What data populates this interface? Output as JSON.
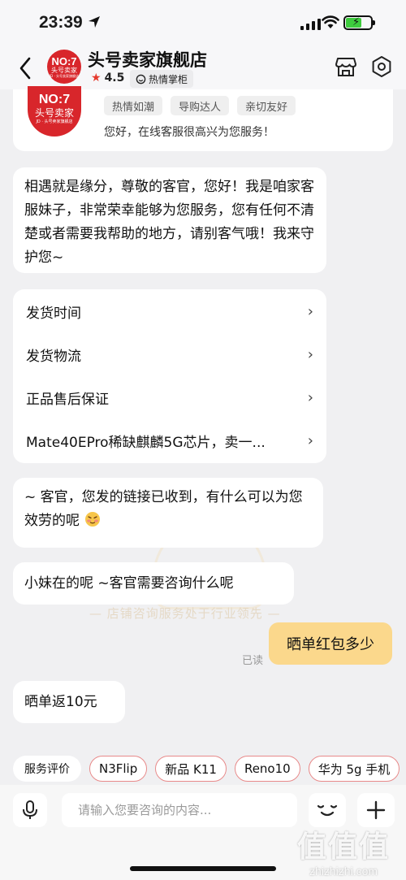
{
  "status_bar": {
    "time": "23:39"
  },
  "header": {
    "logo_line1": "NO:7",
    "logo_line2": "头号卖家",
    "logo_line3": "JD · 头号卖家旗舰店",
    "store_name": "头号卖家旗舰店",
    "rating": "4.5",
    "badge": "热情掌柜"
  },
  "intro": {
    "logo_line1": "NO:7",
    "logo_line2": "头号卖家",
    "logo_line3": "JD · 头号卖家旗舰店",
    "tags": [
      "热情如潮",
      "导购达人",
      "亲切友好"
    ],
    "greeting": "您好，在线客服很高兴为您服务！"
  },
  "messages": {
    "welcome": "相遇就是缘分，尊敬的客官，您好！我是咱家客服妹子，非常荣幸能够为您服务，您有任何不清楚或者需要我帮助的地方，请别客气哦！我来守护您~",
    "faq": [
      {
        "label": "发货时间"
      },
      {
        "label": "发货物流"
      },
      {
        "label": "正品售后保证"
      },
      {
        "label": "Mate40EPro稀缺麒麟5G芯片，卖一..."
      }
    ],
    "link_received": "~ 客官，您发的链接已收到，有什么可以为您效劳的呢",
    "waiting": "小妹在的呢 ~客官需要咨询什么呢",
    "watermark": "店铺咨询服务处于行业领先",
    "user_message": "晒单红包多少",
    "read_status": "已读",
    "reply": "晒单返10元"
  },
  "quick_bar": {
    "label": "服务评价",
    "chips": [
      "N3Flip",
      "新品 K11",
      "Reno10",
      "华为 5g 手机"
    ]
  },
  "input": {
    "placeholder": "请输入您要咨询的内容..."
  },
  "site_watermark": {
    "big": "值值值",
    "small": "zhizhizhi.com"
  },
  "colors": {
    "brand_red": "#d8262b",
    "user_bubble": "#fbd88c",
    "rating_star": "#e53a2e"
  }
}
